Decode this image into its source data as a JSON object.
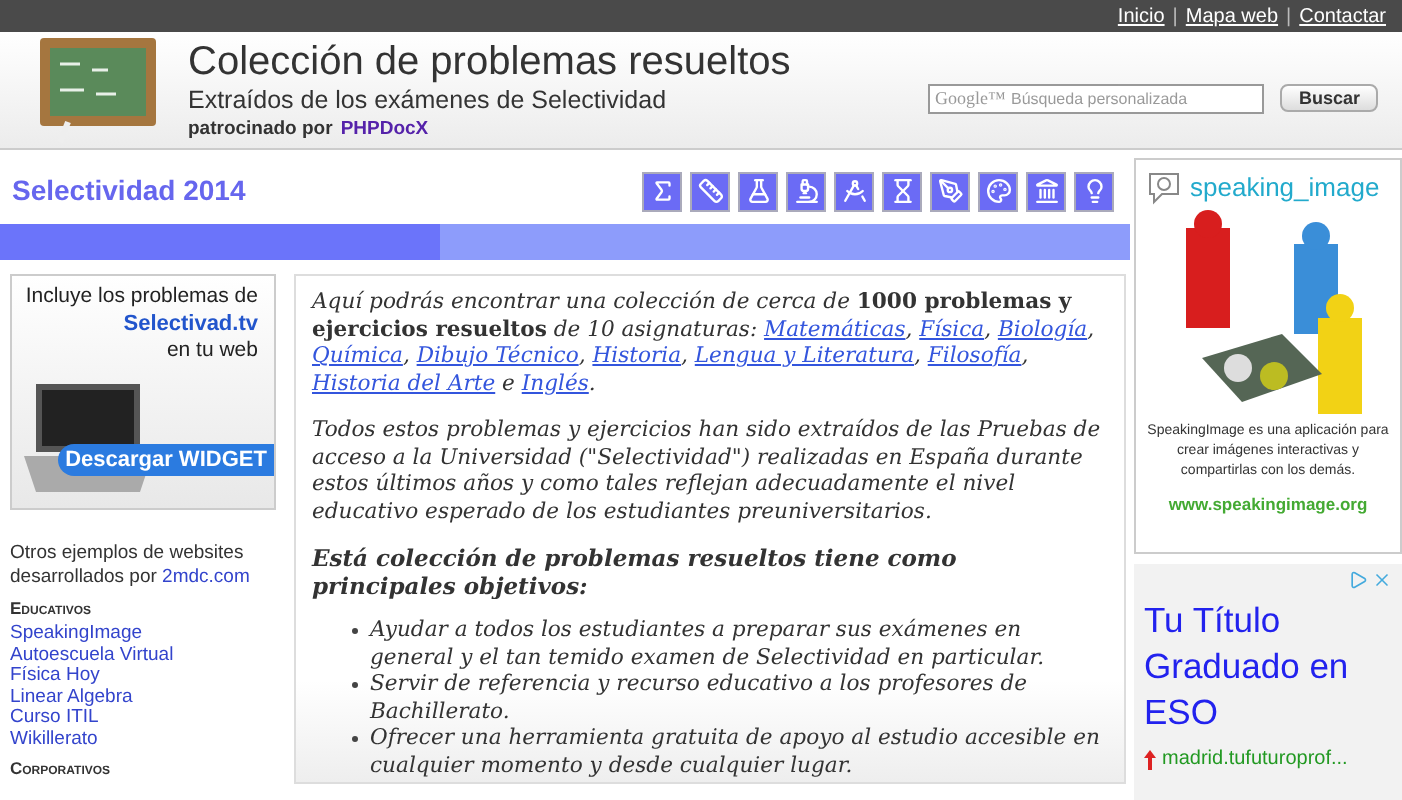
{
  "top_links": [
    "Inicio",
    "Mapa web",
    "Contactar"
  ],
  "top_link_separator": "|",
  "header": {
    "title": "Colección de problemas resueltos",
    "subtitle": "Extraídos de los exámenes de Selectividad",
    "sponsor_label": "patrocinado por",
    "sponsor": "PHPDocX"
  },
  "search": {
    "brand": "Google™",
    "placeholder": "Búsqueda personalizada",
    "button": "Buscar"
  },
  "section_title": "Selectividad 2014",
  "widget": {
    "line1": "Incluye los problemas de",
    "line2": "Selectivad.tv",
    "line3": "en tu web",
    "button": "Descargar WIDGET"
  },
  "others": {
    "intro": "Otros ejemplos de websites desarrollados por",
    "link": "2mdc.com"
  },
  "categories": [
    {
      "title": "Educativos",
      "links": [
        "SpeakingImage",
        "Autoescuela Virtual",
        "Física Hoy",
        "Linear Algebra",
        "Curso ITIL",
        "Wikillerato"
      ]
    },
    {
      "title": "Corporativos"
    }
  ],
  "intro": [
    {
      "kind": "text",
      "text": "Aquí podrás encontrar una colección de cerca de "
    },
    {
      "kind": "bold",
      "text": "1000 problemas y ejercicios resueltos"
    },
    {
      "kind": "text",
      "text": " de 10 asignaturas: "
    },
    {
      "kind": "link",
      "text": "Matemáticas"
    },
    {
      "kind": "text",
      "text": ", "
    },
    {
      "kind": "link",
      "text": "Física"
    },
    {
      "kind": "text",
      "text": ", "
    },
    {
      "kind": "link",
      "text": "Biología"
    },
    {
      "kind": "text",
      "text": ", "
    },
    {
      "kind": "link",
      "text": "Química"
    },
    {
      "kind": "text",
      "text": ", "
    },
    {
      "kind": "link",
      "text": "Dibujo Técnico"
    },
    {
      "kind": "text",
      "text": ", "
    },
    {
      "kind": "link",
      "text": "Historia"
    },
    {
      "kind": "text",
      "text": ", "
    },
    {
      "kind": "link",
      "text": "Lengua y Literatura"
    },
    {
      "kind": "text",
      "text": ", "
    },
    {
      "kind": "link",
      "text": "Filosofía"
    },
    {
      "kind": "text",
      "text": ", "
    },
    {
      "kind": "link",
      "text": "Historia del Arte"
    },
    {
      "kind": "text",
      "text": " e "
    },
    {
      "kind": "link",
      "text": "Inglés"
    },
    {
      "kind": "text",
      "text": "."
    }
  ],
  "paragraph": "Todos estos problemas y ejercicios han sido extraídos de las Pruebas de acceso a la Universidad (\"Selectividad\") realizadas en España durante estos últimos años y como tales reflejan adecuadamente el nivel educativo esperado de los estudiantes preuniversitarios.",
  "objectives_title": "Está colección de problemas resueltos tiene como principales objetivos:",
  "objectives": [
    "Ayudar a todos los estudiantes a preparar sus exámenes en general y el tan temido examen de Selectividad en particular.",
    "Servir de referencia y recurso educativo a los profesores de Bachillerato.",
    "Ofrecer una herramienta gratuita de apoyo al estudio accesible en cualquier momento y desde cualquier lugar."
  ],
  "speaking_ad": {
    "brand": "speaking_image",
    "text": "SpeakingImage es una aplicación para crear imágenes interactivas y compartirlas con los demás.",
    "url": "www.speakingimage.org"
  },
  "ad": {
    "headline": "Tu Título Graduado en ESO",
    "url": "madrid.tufuturoprof..."
  }
}
